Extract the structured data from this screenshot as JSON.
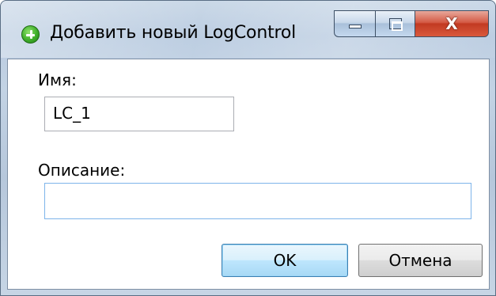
{
  "window": {
    "title": "Добавить новый LogControl",
    "icon": "add-circle-icon",
    "caption_buttons": {
      "minimize": "minimize-icon",
      "maximize": "maximize-icon",
      "close_label": "X"
    }
  },
  "form": {
    "name_label": "Имя:",
    "name_value": "LC_1",
    "description_label": "Описание:",
    "description_value": ""
  },
  "buttons": {
    "ok_label": "OK",
    "cancel_label": "Отмена"
  },
  "colors": {
    "title_icon": "#3fae2a",
    "close_button": "#c23a22",
    "ok_button_border": "#3c7fb1",
    "focused_input_border": "#7eb4ea"
  }
}
